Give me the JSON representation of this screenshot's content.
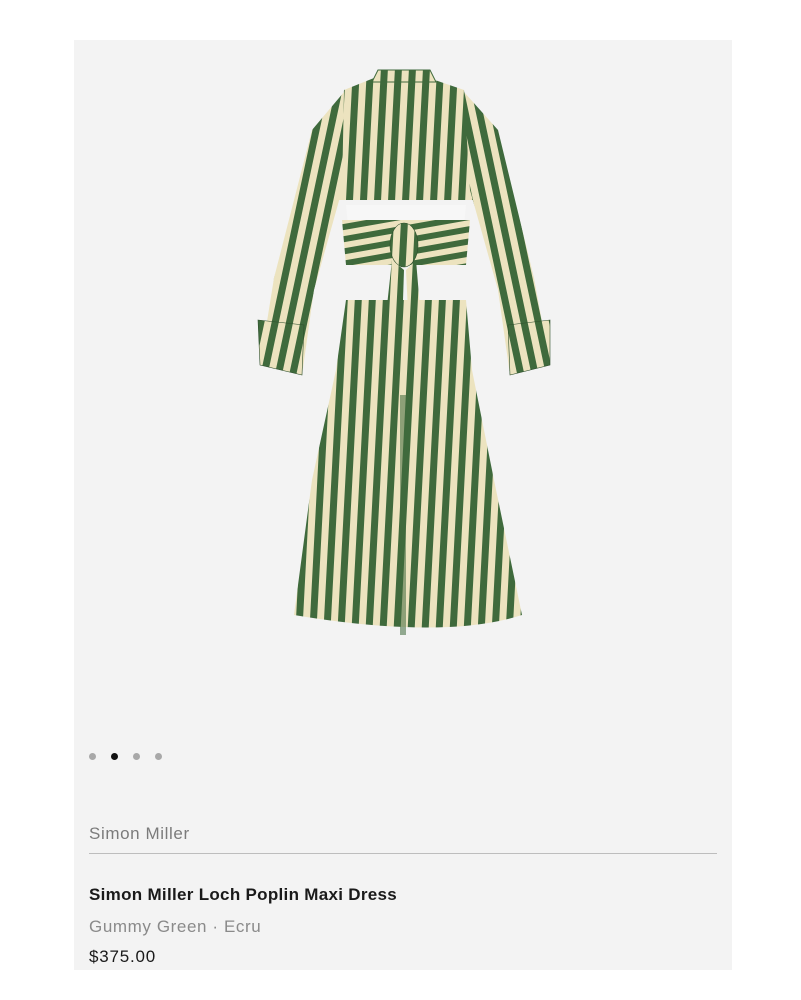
{
  "product": {
    "brand": "Simon Miller",
    "name": "Simon Miller Loch Poplin Maxi Dress",
    "color": "Gummy Green · Ecru",
    "price": "$375.00"
  },
  "gallery": {
    "image_count": 4,
    "active_index": 1,
    "image_subject": "striped-shirt-dress-back-view"
  },
  "colors": {
    "card_background": "#f3f3f3",
    "stripe_green": "#3f6a3c",
    "stripe_ecru": "#ece3bf",
    "active_dot": "#111111",
    "inactive_dot": "#a8a8a8"
  }
}
